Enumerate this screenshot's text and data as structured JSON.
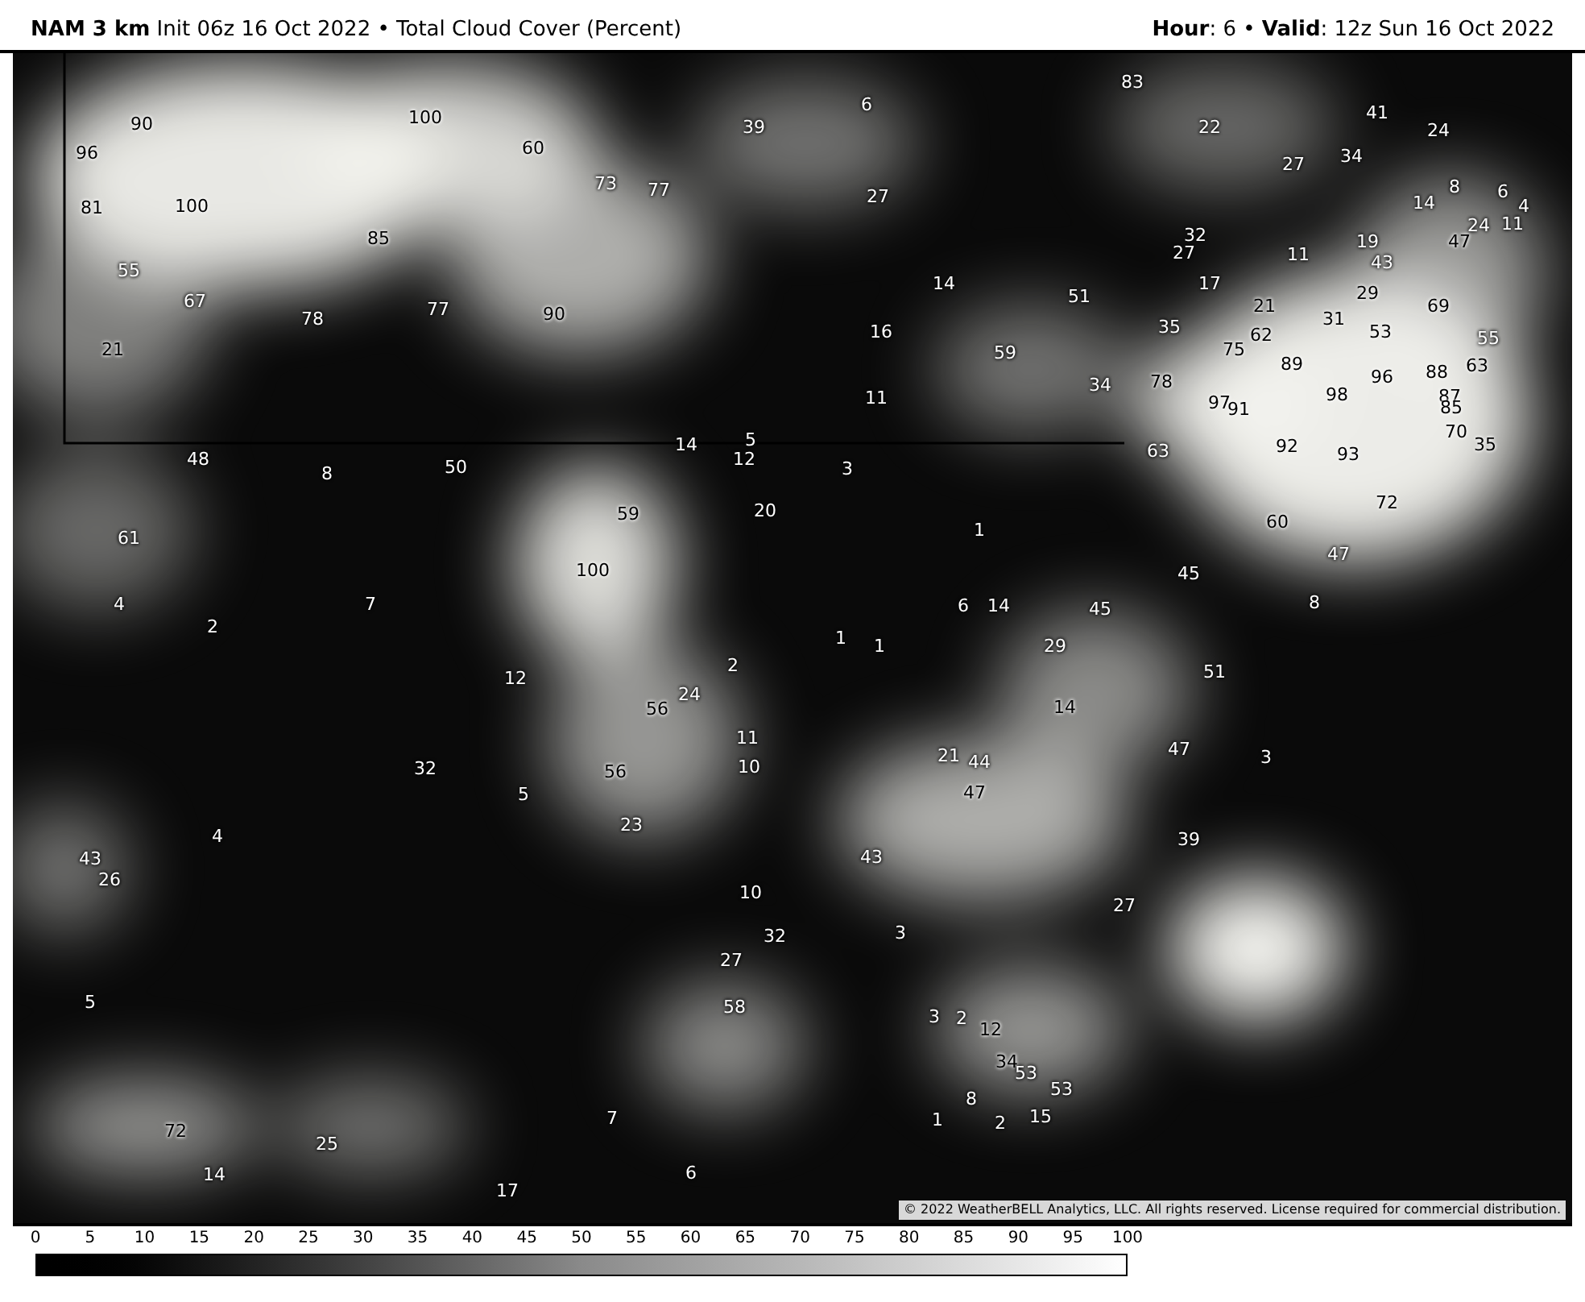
{
  "header": {
    "title": "**NAM 3 km** Init 06z 16 Oct 2022 • Total Cloud Cover (Percent)",
    "valid": "**Hour**: 6 • **Valid**: 12z Sun 16 Oct 2022"
  },
  "map": {
    "labels": [
      "83",
      "6",
      "41",
      "90",
      "100",
      "39",
      "22",
      "24",
      "96",
      "60",
      "34",
      "27",
      "73",
      "77",
      "27",
      "8",
      "6",
      "81",
      "100",
      "14",
      "4",
      "32",
      "24",
      "11",
      "85",
      "19",
      "47",
      "27",
      "11",
      "43",
      "55",
      "14",
      "17",
      "67",
      "51",
      "21",
      "29",
      "69",
      "78",
      "77",
      "90",
      "31",
      "16",
      "35",
      "62",
      "53",
      "55",
      "21",
      "59",
      "75",
      "89",
      "96",
      "88",
      "63",
      "11",
      "34",
      "78",
      "98",
      "97",
      "91",
      "87",
      "85",
      "14",
      "5",
      "70",
      "35",
      "48",
      "12",
      "63",
      "92",
      "93",
      "8",
      "50",
      "3",
      "59",
      "20",
      "72",
      "1",
      "60",
      "61",
      "47",
      "100",
      "45",
      "4",
      "7",
      "6",
      "14",
      "45",
      "8",
      "2",
      "1",
      "1",
      "29",
      "12",
      "2",
      "51",
      "24",
      "14",
      "56",
      "11",
      "47",
      "32",
      "10",
      "21",
      "44",
      "3",
      "56",
      "5",
      "47",
      "4",
      "23",
      "39",
      "43",
      "43",
      "26",
      "10",
      "27",
      "32",
      "3",
      "27",
      "5",
      "58",
      "3",
      "2",
      "12",
      "34",
      "53",
      "8",
      "53",
      "7",
      "1",
      "2",
      "15",
      "72",
      "25",
      "14",
      "6",
      "17"
    ],
    "copyright": "© 2022 WeatherBELL Analytics, LLC. All rights reserved. License required for commercial distribution."
  },
  "legend": {
    "ticks": [
      "0",
      "5",
      "10",
      "15",
      "20",
      "25",
      "30",
      "35",
      "40",
      "45",
      "50",
      "55",
      "60",
      "65",
      "70",
      "75",
      "80",
      "85",
      "90",
      "95",
      "100"
    ]
  }
}
